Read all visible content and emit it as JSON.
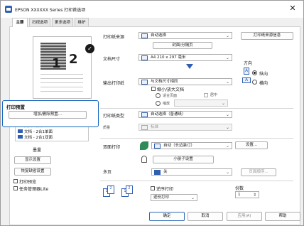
{
  "window": {
    "title": "EPSON XXXXXX Series 打印首选项",
    "close_glyph": "✕"
  },
  "tabs": [
    {
      "label": "主要"
    },
    {
      "label": "扫视选项"
    },
    {
      "label": "更多选项"
    },
    {
      "label": "维护"
    }
  ],
  "preview": {
    "page_number_front": "1",
    "page_number_back": "2",
    "badge_glyph": "✓"
  },
  "presets": {
    "title": "打印预置",
    "add_remove_label": "增加/删除预置...",
    "items": [
      "文档 - 标准",
      "文档 - 2合1单面",
      "文档 - 2合1双面"
    ],
    "show_settings_label": "显示设置",
    "restore_defaults_label": "恢复缺省设置",
    "ink_levels_label": "墨量"
  },
  "options": {
    "show_status_label": "打印预览",
    "job_arranger_label": "任务管理器Lite",
    "paper_source_label": "打印纸来源",
    "paper_source_value": "自动选择",
    "paper_source_info_label": "打印纸来源信息",
    "cover_label": "封面/分隔页",
    "doc_size_label": "文档尺寸",
    "doc_size_value": "A4 210 x 297 毫米",
    "orientation_label": "方向",
    "orientation_portrait": "纵向",
    "orientation_landscape": "横向",
    "output_paper_label": "输出打印纸",
    "output_paper_value": "与文档尺寸相同",
    "reduce_enlarge_label": "缩小/放大文档",
    "fit_to_page_label": "适合页面",
    "percent_label": "缩放",
    "center_label": "居中",
    "paper_type_label": "打印纸类型",
    "paper_type_value": "自动选择（普通纸）",
    "quality_label": "质量",
    "quality_value": "标准",
    "duplex_label": "双面打印",
    "duplex_value": "自动（长边装订）",
    "settings_btn": "设置...",
    "booklet_label": "小册子设置",
    "multipage_label": "多页",
    "multipage_value": "关",
    "page_order_btn": "页面顺序...",
    "reverse_order_label": "逆序打印",
    "collate_value": "逐份打印",
    "copies_label": "份数",
    "copies_value": "1"
  },
  "footer": {
    "ok_label": "确定",
    "cancel_label": "取消",
    "apply_label": "应用(A)",
    "help_label": "帮助"
  },
  "colors": {
    "accent": "#1565c0",
    "icon_blue": "#2f5fb3"
  }
}
